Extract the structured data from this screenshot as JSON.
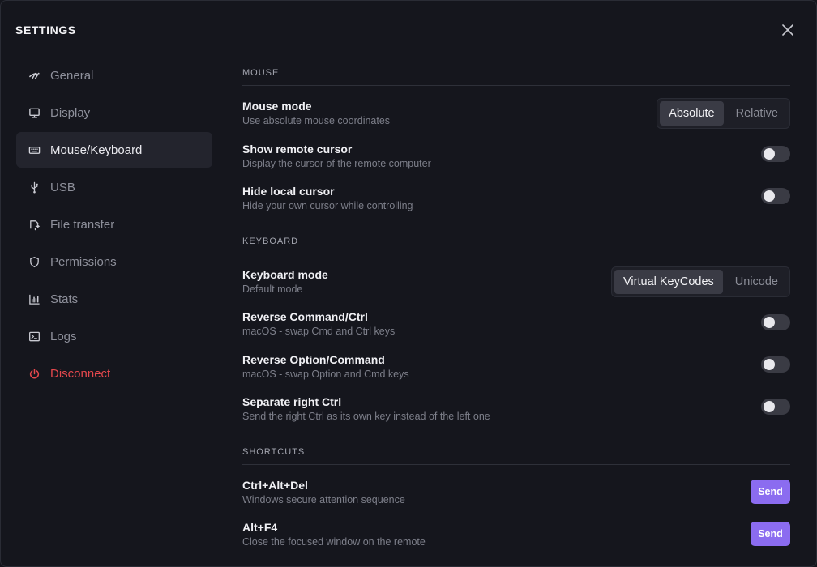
{
  "window": {
    "title": "SETTINGS"
  },
  "sidebar": {
    "items": [
      {
        "label": "General",
        "icon": "general-icon"
      },
      {
        "label": "Display",
        "icon": "monitor-icon"
      },
      {
        "label": "Mouse/Keyboard",
        "icon": "keyboard-icon",
        "active": true
      },
      {
        "label": "USB",
        "icon": "usb-icon"
      },
      {
        "label": "File transfer",
        "icon": "file-transfer-icon"
      },
      {
        "label": "Permissions",
        "icon": "shield-icon"
      },
      {
        "label": "Stats",
        "icon": "chart-icon"
      },
      {
        "label": "Logs",
        "icon": "terminal-icon"
      },
      {
        "label": "Disconnect",
        "icon": "power-icon",
        "danger": true
      }
    ]
  },
  "mouse": {
    "heading": "MOUSE",
    "mode": {
      "label": "Mouse mode",
      "desc": "Use absolute mouse coordinates",
      "options": [
        "Absolute",
        "Relative"
      ],
      "selected": "Absolute"
    },
    "show_cursor": {
      "label": "Show remote cursor",
      "desc": "Display the cursor of the remote computer",
      "on": false
    },
    "hide_cursor": {
      "label": "Hide local cursor",
      "desc": "Hide your own cursor while controlling",
      "on": false
    }
  },
  "keyboard": {
    "heading": "KEYBOARD",
    "mode": {
      "label": "Keyboard mode",
      "desc": "Default mode",
      "options": [
        "Virtual KeyCodes",
        "Unicode"
      ],
      "selected": "Virtual KeyCodes"
    },
    "reverse_cmd": {
      "label": "Reverse Command/Ctrl",
      "desc": "macOS - swap Cmd and Ctrl keys",
      "on": false
    },
    "reverse_opt": {
      "label": "Reverse Option/Command",
      "desc": "macOS - swap Option and Cmd keys",
      "on": false
    },
    "separate_ctrl": {
      "label": "Separate right Ctrl",
      "desc": "Send the right Ctrl as its own key instead of the left one",
      "on": false
    }
  },
  "shortcuts": {
    "heading": "SHORTCUTS",
    "items": [
      {
        "label": "Ctrl+Alt+Del",
        "desc": "Windows secure attention sequence",
        "button": "Send"
      },
      {
        "label": "Alt+F4",
        "desc": "Close the focused window on the remote",
        "button": "Send"
      }
    ]
  },
  "colors": {
    "accent": "#8b6cf0",
    "danger": "#e5484d",
    "background": "#15161d"
  }
}
